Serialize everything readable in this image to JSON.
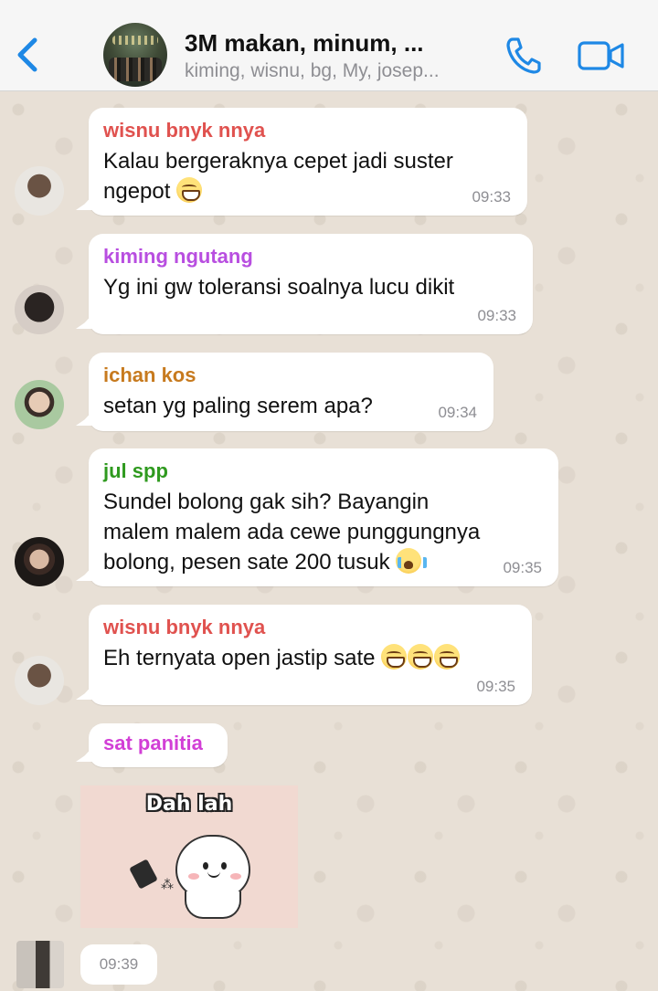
{
  "header": {
    "title": "3M makan, minum, ...",
    "subtitle": "kiming, wisnu, bg, My, josep...",
    "accent_color": "#1e88e5"
  },
  "messages": [
    {
      "sender": "wisnu bnyk nnya",
      "sender_color": "#e0524f",
      "text": "Kalau bergeraknya cepet jadi suster",
      "text2": "ngepot",
      "emoji": "grin",
      "time": "09:33"
    },
    {
      "sender": "kiming ngutang",
      "sender_color": "#b84ee0",
      "text": "Yg ini gw toleransi soalnya lucu dikit",
      "time": "09:33"
    },
    {
      "sender": "ichan kos",
      "sender_color": "#c77a1e",
      "text": "setan yg paling serem apa?",
      "time": "09:34"
    },
    {
      "sender": "jul spp",
      "sender_color": "#2f9a1f",
      "text": "Sundel bolong gak sih? Bayangin",
      "text2": "malem malem ada cewe punggungnya",
      "text3": "bolong, pesen sate 200 tusuk",
      "emoji": "cry",
      "time": "09:35"
    },
    {
      "sender": "wisnu bnyk nnya",
      "sender_color": "#e0524f",
      "text": "Eh ternyata open jastip sate",
      "emoji": "grin grin grin",
      "time": "09:35"
    },
    {
      "sender": "sat panitia",
      "sender_color": "#d23fd6",
      "sticker_caption": "Dah lah",
      "time": "09:39"
    }
  ]
}
